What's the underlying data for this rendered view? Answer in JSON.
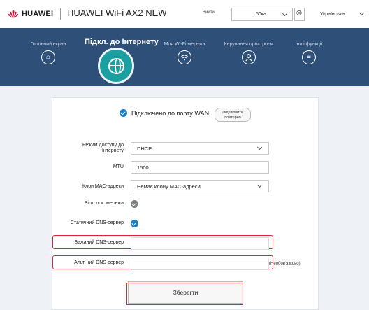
{
  "header": {
    "brand": "HUAWEI",
    "product": "HUAWEI WiFi AX2 NEW",
    "logout": "Вийти",
    "user_value": "50ка.",
    "language": "Українська",
    "logo_color": "#cf0a2c"
  },
  "nav": {
    "items": [
      {
        "label": "Головний екран",
        "icon": "home-icon"
      },
      {
        "label": "Підкл. до Інтернету",
        "icon": "globe-icon"
      },
      {
        "label": "Моя Wi-Fi мережа",
        "icon": "wifi-icon"
      },
      {
        "label": "Керування пристроєм",
        "icon": "user-icon"
      },
      {
        "label": "Інші функції",
        "icon": "menu-icon"
      }
    ],
    "active_index": 1,
    "bar_color": "#2d4f78",
    "active_color": "#1b9fa0"
  },
  "status": {
    "text": "Підключено до порту WAN",
    "reconnect_line1": "Підключити",
    "reconnect_line2": "повторно"
  },
  "form": {
    "access_mode_label_1": "Режим доступу до",
    "access_mode_label_2": "Інтернету",
    "access_mode_value": "DHCP",
    "mtu_label": "MTU",
    "mtu_value": "1500",
    "mac_clone_label": "Клон MAC-адреси",
    "mac_clone_value": "Немає клону MAC-адреси",
    "vlan_label": "Вірт. лок. мережа",
    "static_dns_label": "Статичний DNS-сервер",
    "preferred_dns_label": "Бажаний DNS-сервер",
    "preferred_dns_value": "",
    "alt_dns_label": "Альт-ний DNS-сервер",
    "alt_dns_value": "",
    "optional_note": "(Необов'язково)",
    "save_label": "Зберегти"
  }
}
